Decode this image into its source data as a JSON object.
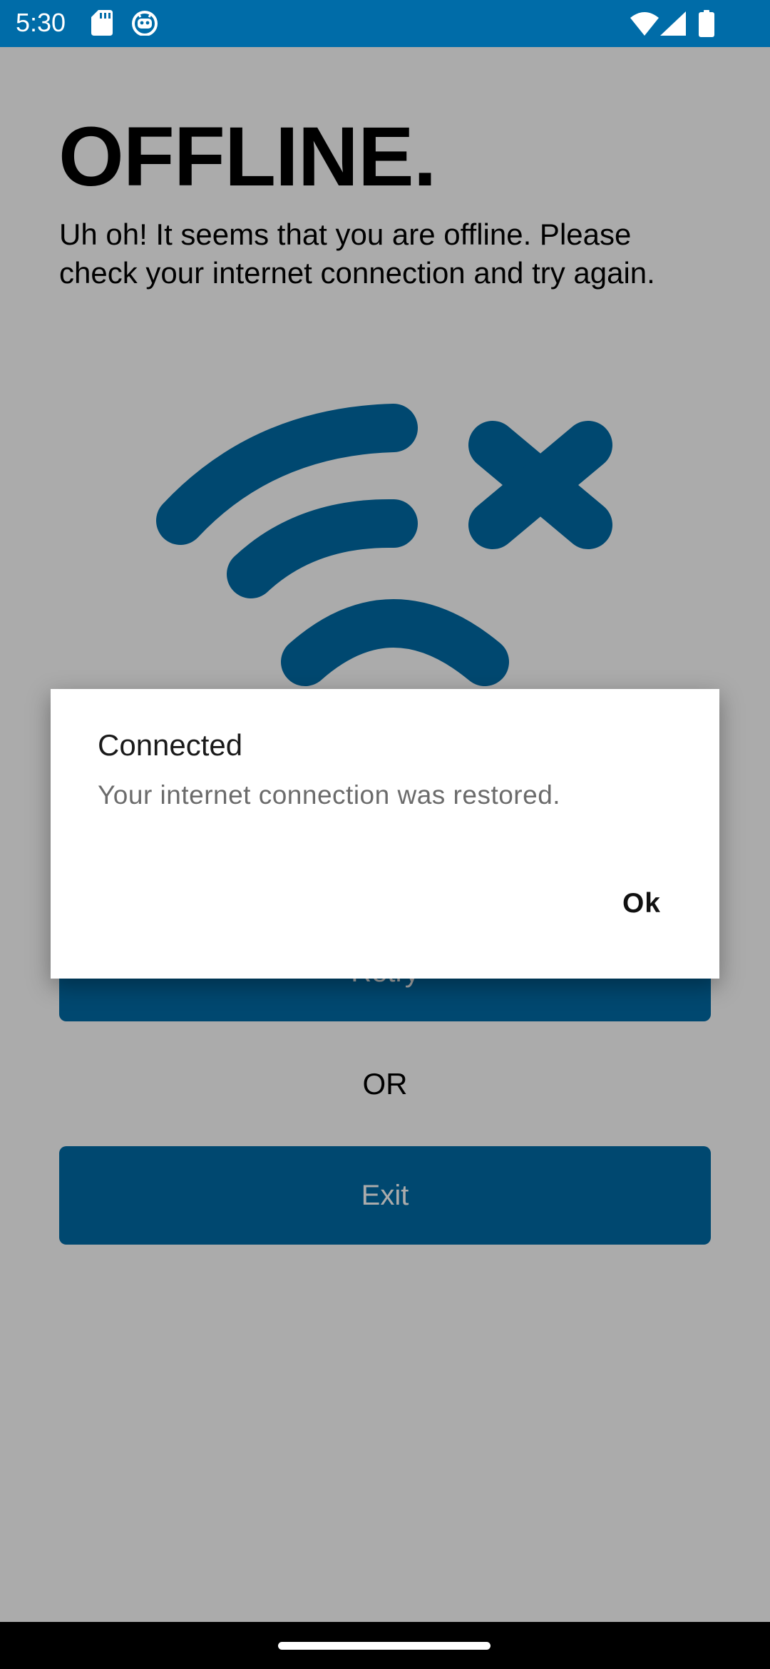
{
  "colors": {
    "brand": "#006ca8",
    "scrim": "rgba(0,0,0,0.33)",
    "dialog_bg": "#ffffff"
  },
  "status_bar": {
    "time": "5:30",
    "icons": [
      "sd-card-icon",
      "android-debug-icon",
      "wifi-icon",
      "cellular-signal-icon",
      "battery-icon"
    ]
  },
  "offline": {
    "title": "OFFLINE.",
    "message": "Uh oh! It seems that you are offline. Please check your internet connection and try again.",
    "illustration": "wifi-off-icon",
    "retry_label": "Retry",
    "or_label": "OR",
    "exit_label": "Exit"
  },
  "dialog": {
    "title": "Connected",
    "message": "Your internet connection was restored.",
    "ok_label": "Ok"
  }
}
